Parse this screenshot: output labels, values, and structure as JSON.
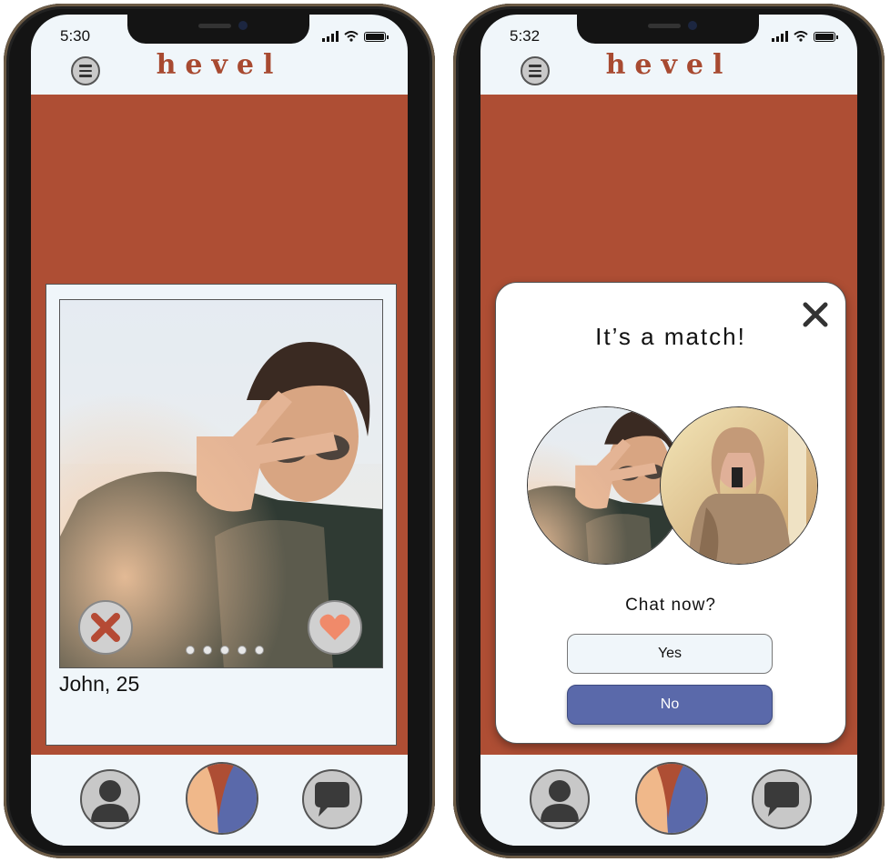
{
  "app": {
    "name": "hevel"
  },
  "colors": {
    "brand": "#ae4e34",
    "surface": "#f0f6fa",
    "accent": "#5a69aa",
    "peach": "#f0b88a",
    "like": "#f08a6a"
  },
  "screens": {
    "swipe": {
      "status_time": "5:30",
      "profile": {
        "name_age": "John, 25",
        "photo_count": 5,
        "active_photo_index": 0
      },
      "actions": {
        "dislike_icon": "x-icon",
        "like_icon": "heart-icon"
      }
    },
    "match": {
      "status_time": "5:32",
      "title": "It’s a match!",
      "prompt": "Chat now?",
      "yes_label": "Yes",
      "no_label": "No",
      "close_icon": "close-icon"
    }
  },
  "bottom_nav": {
    "items": [
      {
        "icon": "profile-icon"
      },
      {
        "icon": "discover-icon"
      },
      {
        "icon": "chat-icon"
      }
    ]
  }
}
